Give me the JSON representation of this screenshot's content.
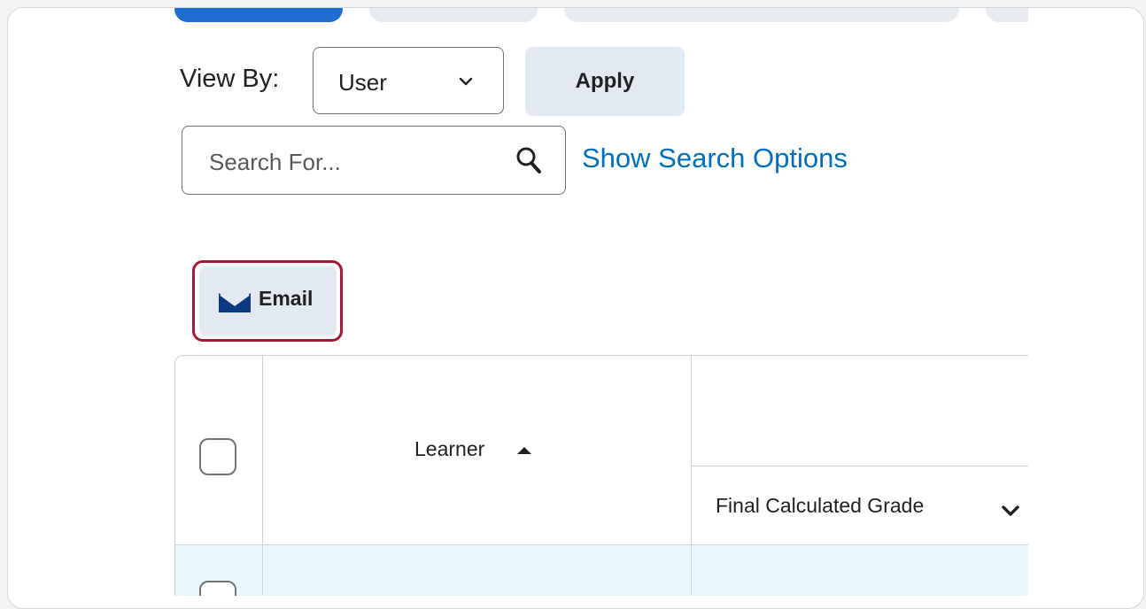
{
  "view_by": {
    "label": "View By:",
    "selected": "User",
    "apply_label": "Apply"
  },
  "search": {
    "placeholder": "Search For...",
    "options_link": "Show Search Options"
  },
  "actions": {
    "email_label": "Email"
  },
  "grid": {
    "columns": {
      "learner": "Learner",
      "final_grade": "Final Calculated Grade"
    }
  },
  "colors": {
    "accent": "#006fbf",
    "highlight_outline": "#a31b38",
    "row_selected": "#e8f7fc"
  },
  "icons": [
    "chevron-down-icon",
    "search-icon",
    "email-icon",
    "sort-ascending-icon"
  ]
}
